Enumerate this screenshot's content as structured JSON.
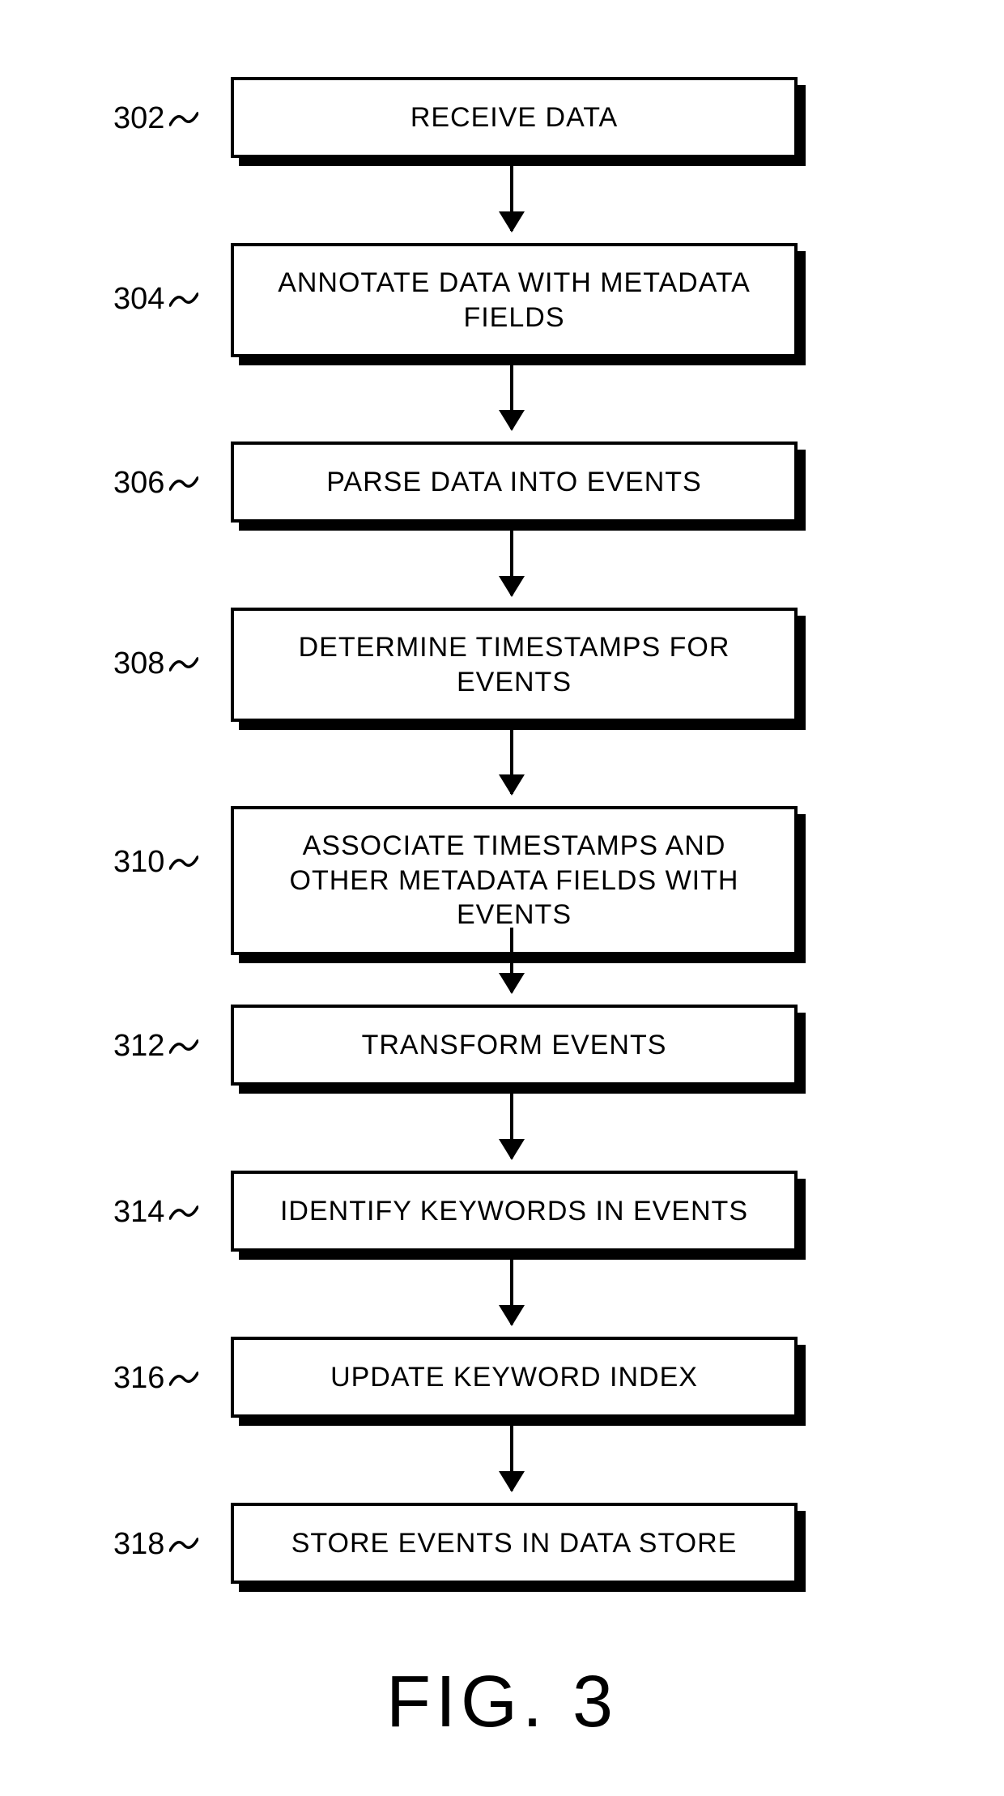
{
  "figure_label": "FIG. 3",
  "steps": [
    {
      "ref": "302",
      "text": "RECEIVE DATA"
    },
    {
      "ref": "304",
      "text": "ANNOTATE DATA WITH METADATA FIELDS"
    },
    {
      "ref": "306",
      "text": "PARSE DATA INTO EVENTS"
    },
    {
      "ref": "308",
      "text": "DETERMINE TIMESTAMPS FOR EVENTS"
    },
    {
      "ref": "310",
      "text": "ASSOCIATE TIMESTAMPS AND OTHER METADATA FIELDS WITH EVENTS"
    },
    {
      "ref": "312",
      "text": "TRANSFORM EVENTS"
    },
    {
      "ref": "314",
      "text": "IDENTIFY KEYWORDS IN EVENTS"
    },
    {
      "ref": "316",
      "text": "UPDATE KEYWORD INDEX"
    },
    {
      "ref": "318",
      "text": "STORE EVENTS IN DATA STORE"
    }
  ]
}
